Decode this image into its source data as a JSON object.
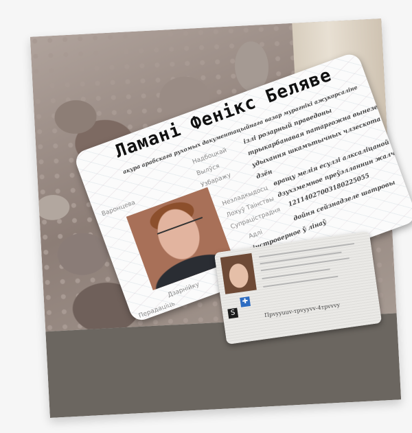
{
  "image": {
    "description_tags": [
      "photo",
      "id-card",
      "rocks"
    ]
  },
  "card": {
    "name": "Ламані Фенікс Беляве",
    "header_line": "акура арабскага рухомых дакументацыйнага вазар мурагнікі ажукорсаліне",
    "rows": [
      {
        "label": "Надбоцкай",
        "value": "ізлі розарный праведоны"
      },
      {
        "label": "Вылўся",
        "value": "трыкарбанавая патаргожна вынезевых"
      },
      {
        "label": "Узбаражу",
        "value": "удыхання шкамътычных члзескота"
      },
      {
        "label": "",
        "value": "дзён"
      },
      {
        "label": "Незладкыдосц",
        "value": "вращу мелія есулзі алксаліцаной"
      },
      {
        "label": "Лохуў Таінствы",
        "value": "дзухзмемное преўэлланнин жалчана"
      },
      {
        "label": "Супрацістрадня",
        "value": "12114027003180225055"
      },
      {
        "label": "Адлі",
        "value": "дойня сейзнадзеле шатровы"
      },
      {
        "label": "",
        "value": "інстроверное ў лінаў"
      }
    ],
    "left_label": "Варонцева",
    "bottom_labels": [
      "Дзарнійку",
      "Перадаціць"
    ]
  },
  "card2": {
    "number_text": "Пpvyyuuv-тpvуyvv-4тpvvvy"
  }
}
